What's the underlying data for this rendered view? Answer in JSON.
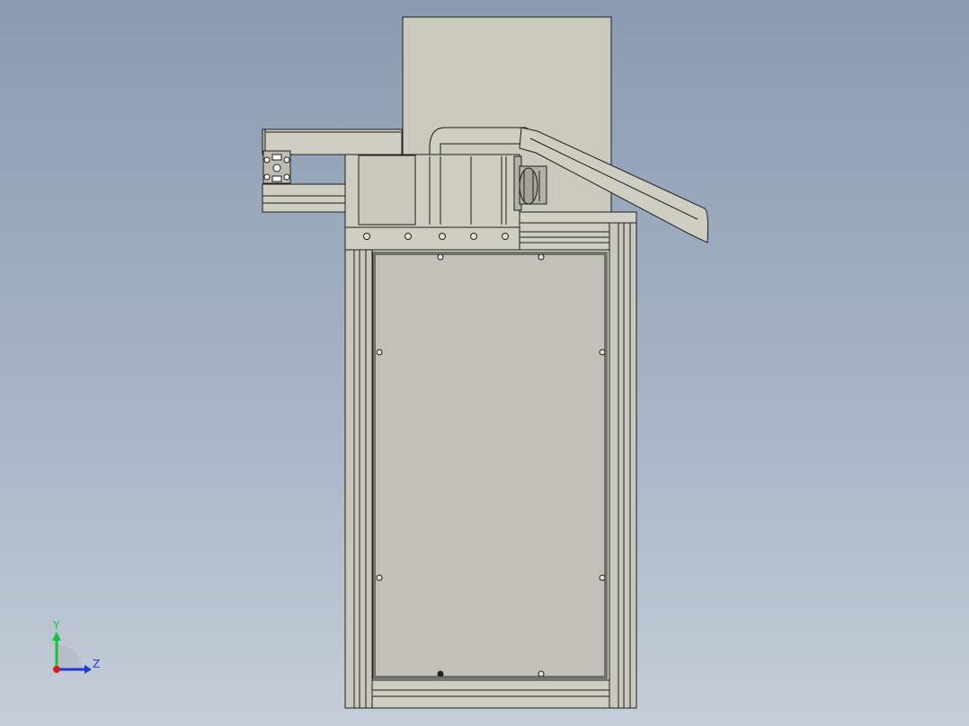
{
  "viewport": {
    "background_top": "#8a9bb1",
    "background_bottom": "#c5cdd8",
    "part_fill": "#c9c8bd",
    "part_fill_light": "#d2d1c6",
    "edge_color": "#1e1e1e"
  },
  "triad": {
    "y_label": "Y",
    "z_label": "Z",
    "y_color": "#19c23a",
    "z_color": "#1e3bd6",
    "x_color": "#d61e1e"
  }
}
